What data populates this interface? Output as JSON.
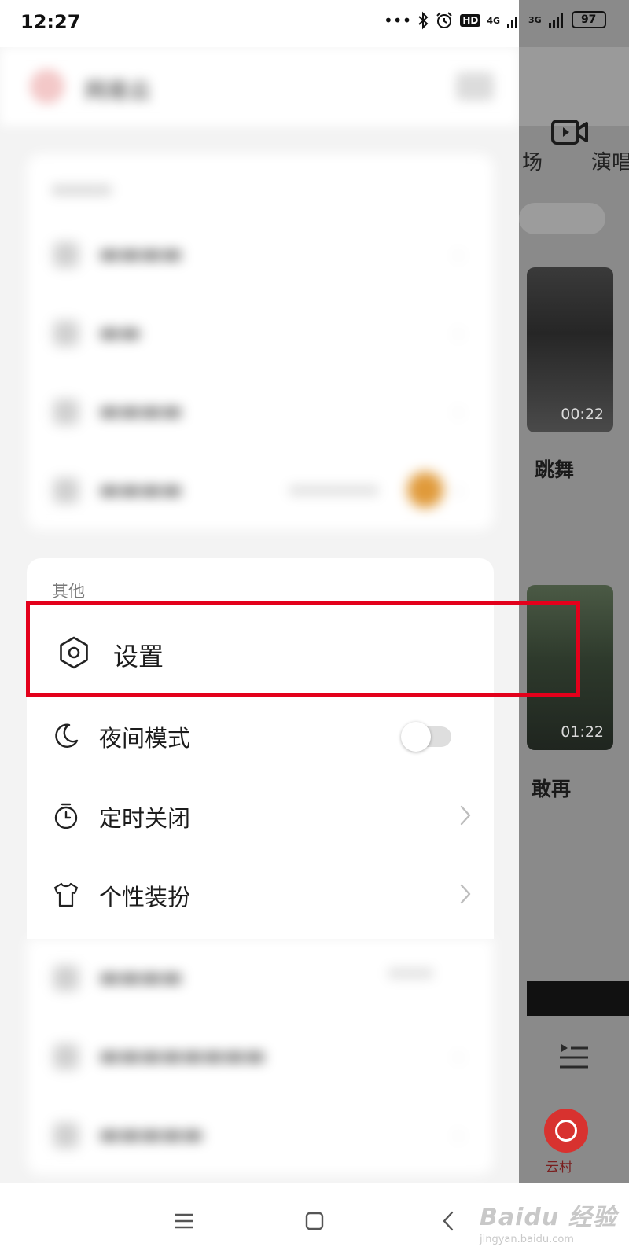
{
  "status_bar": {
    "time": "12:27",
    "dots": "•••",
    "network_1": "4G",
    "network_2": "3G",
    "hd": "HD",
    "battery": "97"
  },
  "background_app": {
    "tab_1": "场",
    "tab_2": "演唱",
    "video_1": {
      "duration": "00:22",
      "caption": "跳舞"
    },
    "video_2": {
      "duration": "01:22",
      "caption": "敢再"
    },
    "cloud_label": "云村"
  },
  "drawer": {
    "header": {
      "username": "网易云"
    },
    "other_section": {
      "label": "其他",
      "items": [
        {
          "label": "设置",
          "icon": "settings-hexagon-icon",
          "type": "link"
        },
        {
          "label": "夜间模式",
          "icon": "moon-icon",
          "type": "toggle",
          "on": false
        },
        {
          "label": "定时关闭",
          "icon": "timer-icon",
          "type": "link"
        },
        {
          "label": "个性装扮",
          "icon": "tshirt-icon",
          "type": "link"
        }
      ]
    }
  },
  "nav_bar": {
    "buttons": [
      "menu-icon",
      "home-icon",
      "back-icon"
    ]
  },
  "watermark": {
    "main": "Baidu 经验",
    "sub": "jingyan.baidu.com"
  },
  "colors": {
    "highlight": "#e3001b",
    "brand_red": "#d8322f",
    "overlay_dim": "#8a8a8a"
  }
}
